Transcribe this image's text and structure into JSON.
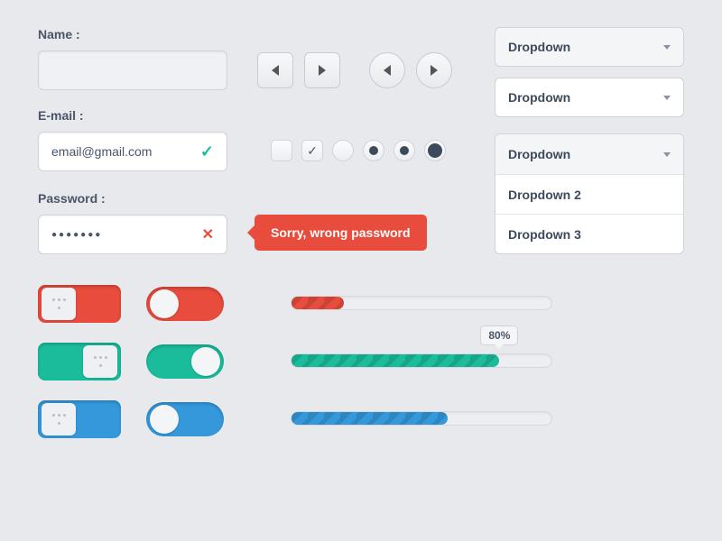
{
  "form": {
    "name_label": "Name :",
    "email_label": "E-mail :",
    "email_value": "email@gmail.com",
    "password_label": "Password :",
    "password_value": "●●●●●●●",
    "error_message": "Sorry, wrong password"
  },
  "dropdowns": {
    "d1": "Dropdown",
    "d2": "Dropdown",
    "open": [
      "Dropdown",
      "Dropdown 2",
      "Dropdown 3"
    ]
  },
  "progress": {
    "red": 20,
    "green": 80,
    "green_label": "80%",
    "blue": 60
  },
  "colors": {
    "red": "#e74c3c",
    "green": "#1abc9c",
    "blue": "#3498db"
  }
}
